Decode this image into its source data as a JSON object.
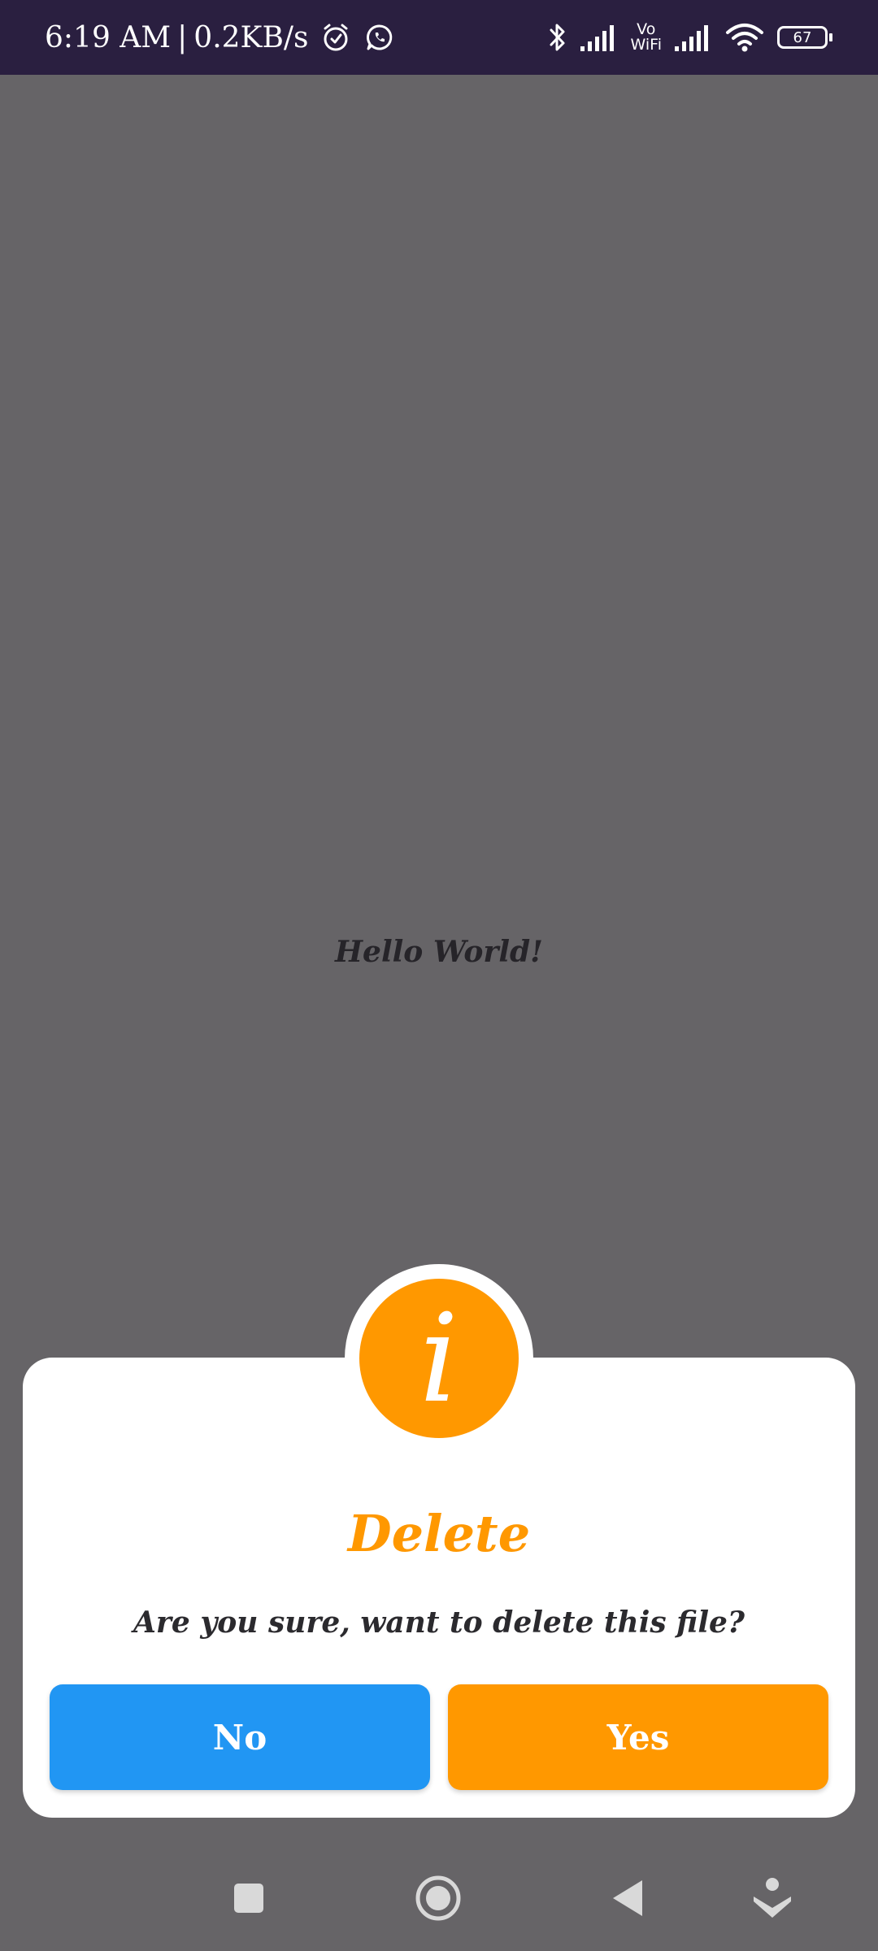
{
  "status_bar": {
    "time": "6:19 AM",
    "separator": "|",
    "network_speed": "0.2KB/s",
    "vowifi_top": "Vo",
    "vowifi_bottom": "WiFi",
    "battery_level": "67",
    "icons": [
      "alarm-icon",
      "whatsapp-icon",
      "bluetooth-icon",
      "signal-icon",
      "vowifi-icon",
      "signal-icon",
      "wifi-icon",
      "battery-icon"
    ]
  },
  "main": {
    "text": "Hello World!"
  },
  "dialog": {
    "icon": "info-icon",
    "icon_glyph": "i",
    "title": "Delete",
    "message": "Are you sure, want to delete this file?",
    "no_label": "No",
    "yes_label": "Yes"
  },
  "nav_bar": {
    "buttons": [
      "recents-icon",
      "home-icon",
      "back-icon",
      "assistant-icon"
    ]
  },
  "colors": {
    "background_dim": "#666467",
    "status_bar": "#2a1f40",
    "accent_orange": "#ff9800",
    "no_button_blue": "#2196f3",
    "text_dark": "#262429",
    "white": "#ffffff"
  }
}
